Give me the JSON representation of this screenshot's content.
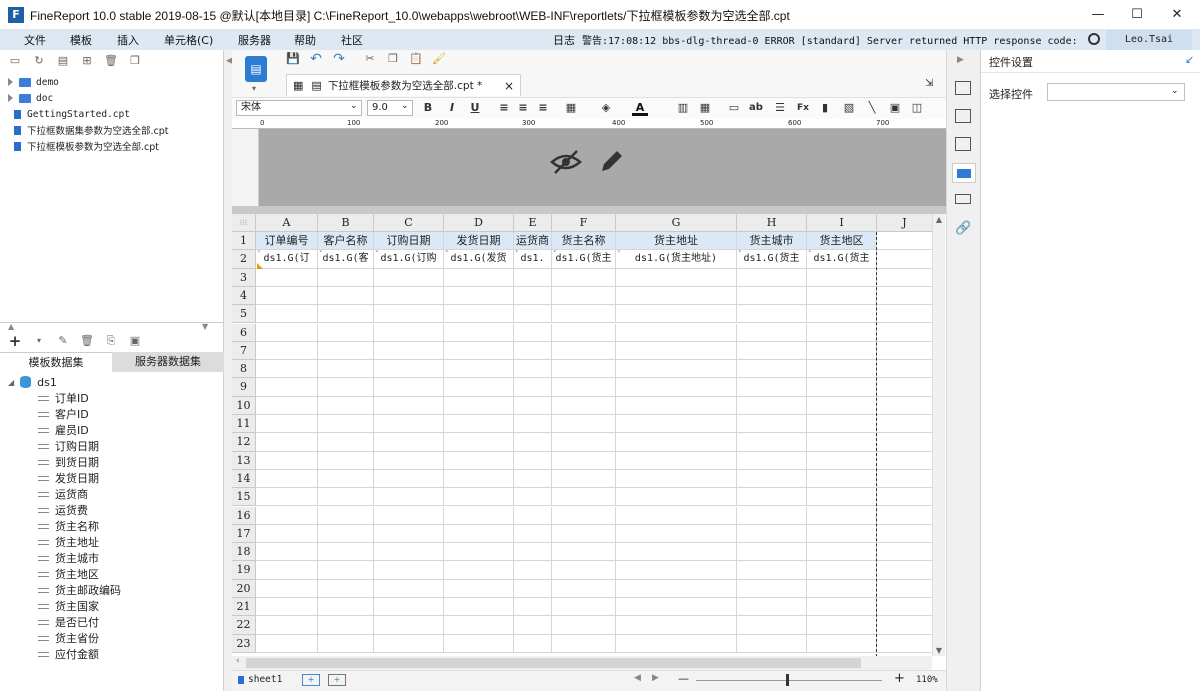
{
  "window": {
    "title": "FineReport 10.0 stable 2019-08-15 @默认[本地目录]   C:\\FineReport_10.0\\webapps\\webroot\\WEB-INF\\reportlets/下拉框模板参数为空选全部.cpt",
    "minimize": "—",
    "maximize": "☐",
    "close": "✕"
  },
  "menu": [
    "文件",
    "模板",
    "插入",
    "单元格(C)",
    "服务器",
    "帮助",
    "社区"
  ],
  "status": {
    "log_label": "日志",
    "message": "警告:17:08:12 bbs-dlg-thread-0 ERROR [standard] Server returned HTTP response code: 405 fo...",
    "user": "Leo.Tsai"
  },
  "file_tree": [
    {
      "type": "folder",
      "name": "demo"
    },
    {
      "type": "folder",
      "name": "doc"
    },
    {
      "type": "file",
      "name": "GettingStarted.cpt"
    },
    {
      "type": "file",
      "name": "下拉框数据集参数为空选全部.cpt"
    },
    {
      "type": "file",
      "name": "下拉框模板参数为空选全部.cpt"
    }
  ],
  "dataset_tabs": [
    "模板数据集",
    "服务器数据集"
  ],
  "dataset": {
    "name": "ds1",
    "fields": [
      "订单ID",
      "客户ID",
      "雇员ID",
      "订购日期",
      "到货日期",
      "发货日期",
      "运货商",
      "运货费",
      "货主名称",
      "货主地址",
      "货主城市",
      "货主地区",
      "货主邮政编码",
      "货主国家",
      "是否已付",
      "货主省份",
      "应付金额"
    ]
  },
  "file_tab": {
    "label": "下拉框模板参数为空选全部.cpt *",
    "close": "×"
  },
  "format": {
    "font": "宋体",
    "size": "9.0"
  },
  "ruler_marks": [
    "0",
    "100",
    "200",
    "300",
    "400",
    "500",
    "600",
    "700"
  ],
  "grid": {
    "columns": [
      "A",
      "B",
      "C",
      "D",
      "E",
      "F",
      "G",
      "H",
      "I",
      "J"
    ],
    "row_numbers": [
      "1",
      "2",
      "3",
      "4",
      "5",
      "6",
      "7",
      "8",
      "9",
      "10",
      "11",
      "12",
      "13",
      "14",
      "15",
      "16",
      "17",
      "18",
      "19",
      "20",
      "21",
      "22",
      "23"
    ],
    "header_row": [
      "订单编号",
      "客户名称",
      "订购日期",
      "发货日期",
      "运货商",
      "货主名称",
      "货主地址",
      "货主城市",
      "货主地区",
      ""
    ],
    "data_row": [
      "ds1.G(订",
      "ds1.G(客",
      "ds1.G(订购",
      "ds1.G(发货",
      "ds1.",
      "ds1.G(货主",
      "ds1.G(货主地址)",
      "ds1.G(货主",
      "ds1.G(货主",
      ""
    ]
  },
  "sheet": {
    "name": "sheet1",
    "zoom": "110%",
    "zoom_minus": "—",
    "zoom_plus": "+"
  },
  "right_panel": {
    "title": "控件设置",
    "select_label": "选择控件",
    "select_value": ""
  }
}
